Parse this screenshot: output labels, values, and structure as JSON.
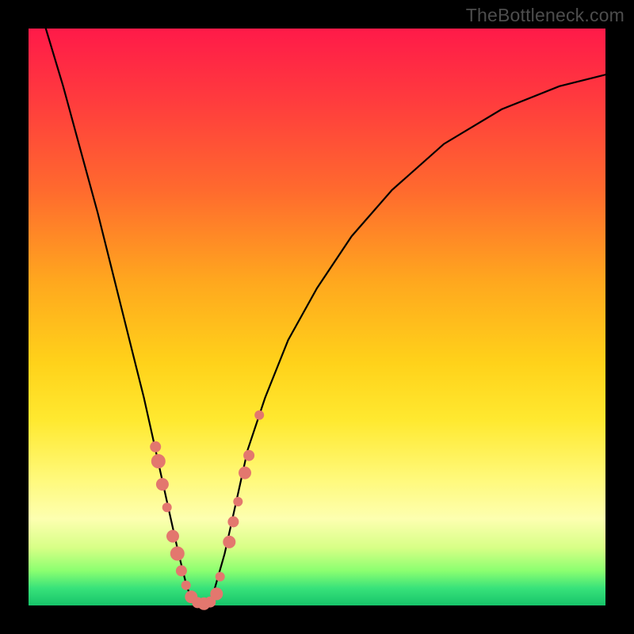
{
  "watermark": "TheBottleneck.com",
  "chart_data": {
    "type": "line",
    "title": "",
    "xlabel": "",
    "ylabel": "",
    "xlim": [
      0,
      100
    ],
    "ylim": [
      0,
      100
    ],
    "series": [
      {
        "name": "bottleneck-curve",
        "x": [
          3,
          6,
          9,
          12,
          15,
          18,
          20,
          22,
          24,
          26,
          27.5,
          29,
          30,
          31,
          32,
          34,
          36,
          38,
          41,
          45,
          50,
          56,
          63,
          72,
          82,
          92,
          100
        ],
        "y": [
          100,
          90,
          79,
          68,
          56,
          44,
          36,
          27,
          18,
          9,
          3,
          0,
          0,
          0,
          2,
          9,
          18,
          27,
          36,
          46,
          55,
          64,
          72,
          80,
          86,
          90,
          92
        ]
      }
    ],
    "beads": {
      "name": "highlight-points",
      "points": [
        {
          "x": 22.0,
          "y": 27.5,
          "r": 7
        },
        {
          "x": 22.5,
          "y": 25.0,
          "r": 9
        },
        {
          "x": 23.2,
          "y": 21.0,
          "r": 8
        },
        {
          "x": 24.0,
          "y": 17.0,
          "r": 6
        },
        {
          "x": 25.0,
          "y": 12.0,
          "r": 8
        },
        {
          "x": 25.8,
          "y": 9.0,
          "r": 9
        },
        {
          "x": 26.5,
          "y": 6.0,
          "r": 7
        },
        {
          "x": 27.3,
          "y": 3.5,
          "r": 6
        },
        {
          "x": 28.2,
          "y": 1.5,
          "r": 8
        },
        {
          "x": 29.3,
          "y": 0.5,
          "r": 7
        },
        {
          "x": 30.4,
          "y": 0.3,
          "r": 8
        },
        {
          "x": 31.5,
          "y": 0.6,
          "r": 7
        },
        {
          "x": 32.6,
          "y": 2.0,
          "r": 8
        },
        {
          "x": 33.2,
          "y": 5.0,
          "r": 6
        },
        {
          "x": 34.8,
          "y": 11.0,
          "r": 8
        },
        {
          "x": 35.5,
          "y": 14.5,
          "r": 7
        },
        {
          "x": 36.3,
          "y": 18.0,
          "r": 6
        },
        {
          "x": 37.5,
          "y": 23.0,
          "r": 8
        },
        {
          "x": 38.2,
          "y": 26.0,
          "r": 7
        },
        {
          "x": 40.0,
          "y": 33.0,
          "r": 6
        }
      ]
    },
    "gradient_stops": [
      {
        "pos": 0,
        "color": "#ff1a49"
      },
      {
        "pos": 28,
        "color": "#ff6a2e"
      },
      {
        "pos": 58,
        "color": "#ffd21a"
      },
      {
        "pos": 85,
        "color": "#fdffb0"
      },
      {
        "pos": 100,
        "color": "#17c46a"
      }
    ]
  }
}
